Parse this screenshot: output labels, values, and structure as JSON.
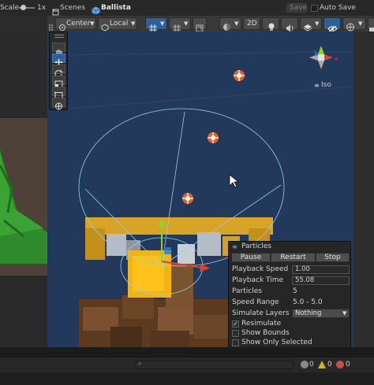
{
  "topbar": {
    "scale_label": "Scale",
    "scale_value": "1x",
    "scenes_tab": "Scenes",
    "scene_name": "Ballista",
    "save_label": "Save",
    "auto_save_label": "Auto Save"
  },
  "scene_toolbar": {
    "pivot_mode": "Center",
    "pivot_rotation": "Local",
    "mode_2d": "2D"
  },
  "gizmo": {
    "projection": "Iso"
  },
  "particles": {
    "title": "Particles",
    "pause_label": "Pause",
    "restart_label": "Restart",
    "stop_label": "Stop",
    "playback_speed_label": "Playback Speed",
    "playback_speed_value": "1.00",
    "playback_time_label": "Playback Time",
    "playback_time_value": "55.08",
    "particles_label": "Particles",
    "particles_value": "5",
    "speed_range_label": "Speed Range",
    "speed_range_value": "5.0 - 5.0",
    "simulate_layers_label": "Simulate Layers",
    "simulate_layers_value": "Nothing",
    "resimulate_label": "Resimulate",
    "resimulate_checked": true,
    "show_bounds_label": "Show Bounds",
    "show_bounds_checked": false,
    "show_only_selected_label": "Show Only Selected",
    "show_only_selected_checked": false
  },
  "status": {
    "warning_count": "0",
    "error_count": "0",
    "info_count": "0"
  },
  "colors": {
    "viewport_bg": "#23395c",
    "accent_blue": "#2f5f98",
    "gizmo_red": "#e0402c",
    "gizmo_green": "#8fd32a",
    "gizmo_blue": "#2f7bd8"
  }
}
